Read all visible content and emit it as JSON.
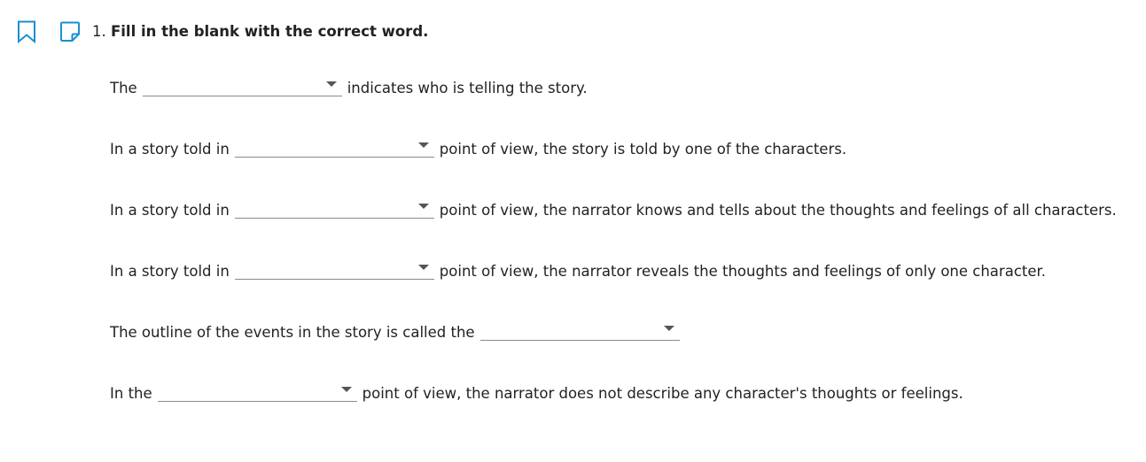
{
  "question": {
    "number": "1.",
    "prompt": "Fill in the blank with the correct word."
  },
  "icons": {
    "bookmark": "bookmark-icon",
    "note": "note-icon",
    "dropdown": "chevron-down-icon"
  },
  "colors": {
    "accent": "#1a8fd1",
    "text": "#222222",
    "blank_line": "#8a8a8a"
  },
  "rows": [
    {
      "before": "The",
      "selected": "",
      "after": "indicates who is telling the story."
    },
    {
      "before": "In a story told in",
      "selected": "",
      "after": "point of view, the story is told by one of the characters."
    },
    {
      "before": "In a story told in",
      "selected": "",
      "after": "point of view, the narrator knows and tells about the thoughts and feelings of all characters."
    },
    {
      "before": "In a story told in",
      "selected": "",
      "after": "point of view, the narrator reveals the thoughts and feelings of only one character."
    },
    {
      "before": "The outline of the events in the story is called the",
      "selected": "",
      "after": ""
    },
    {
      "before": "In the",
      "selected": "",
      "after": "point of view, the narrator does not describe any character's thoughts or feelings."
    }
  ]
}
